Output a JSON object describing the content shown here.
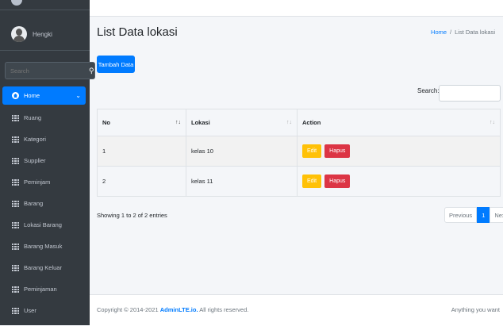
{
  "sidebar": {
    "user": "Hengki",
    "search_placeholder": "Search",
    "search_icon": "magnifier-icon",
    "items": [
      {
        "label": "Home",
        "active": true,
        "icon": "home-icon"
      },
      {
        "label": "Ruang",
        "icon": "table-icon"
      },
      {
        "label": "Kategori",
        "icon": "table-icon"
      },
      {
        "label": "Supplier",
        "icon": "table-icon"
      },
      {
        "label": "Peminjam",
        "icon": "table-icon"
      },
      {
        "label": "Barang",
        "icon": "table-icon"
      },
      {
        "label": "Lokasi Barang",
        "icon": "table-icon"
      },
      {
        "label": "Barang Masuk",
        "icon": "table-icon"
      },
      {
        "label": "Barang Keluar",
        "icon": "table-icon"
      },
      {
        "label": "Peminjaman",
        "icon": "table-icon"
      },
      {
        "label": "User",
        "icon": "table-icon"
      }
    ]
  },
  "header": {
    "title": "List Data lokasi",
    "breadcrumb_home": "Home",
    "breadcrumb_sep": "/",
    "breadcrumb_current": "List Data lokasi"
  },
  "actions": {
    "add_label": "Tambah Data"
  },
  "datatable": {
    "search_label": "Search:",
    "columns": [
      "No",
      "Lokasi",
      "Action"
    ],
    "rows": [
      {
        "no": "1",
        "lokasi": "kelas 10"
      },
      {
        "no": "2",
        "lokasi": "kelas 11"
      }
    ],
    "edit_label": "Edit",
    "hapus_label": "Hapus",
    "info": "Showing 1 to 2 of 2 entries",
    "prev": "Previous",
    "current_page": "1",
    "next": "Next"
  },
  "footer": {
    "copyright_prefix": "Copyright © 2014-2021",
    "brand": "AdminLTE.io.",
    "rights": "All rights reserved.",
    "right_text": "Anything you want"
  },
  "colors": {
    "primary": "#007bff",
    "sidebar": "#343a40",
    "warning": "#ffc107",
    "danger": "#dc3545"
  }
}
